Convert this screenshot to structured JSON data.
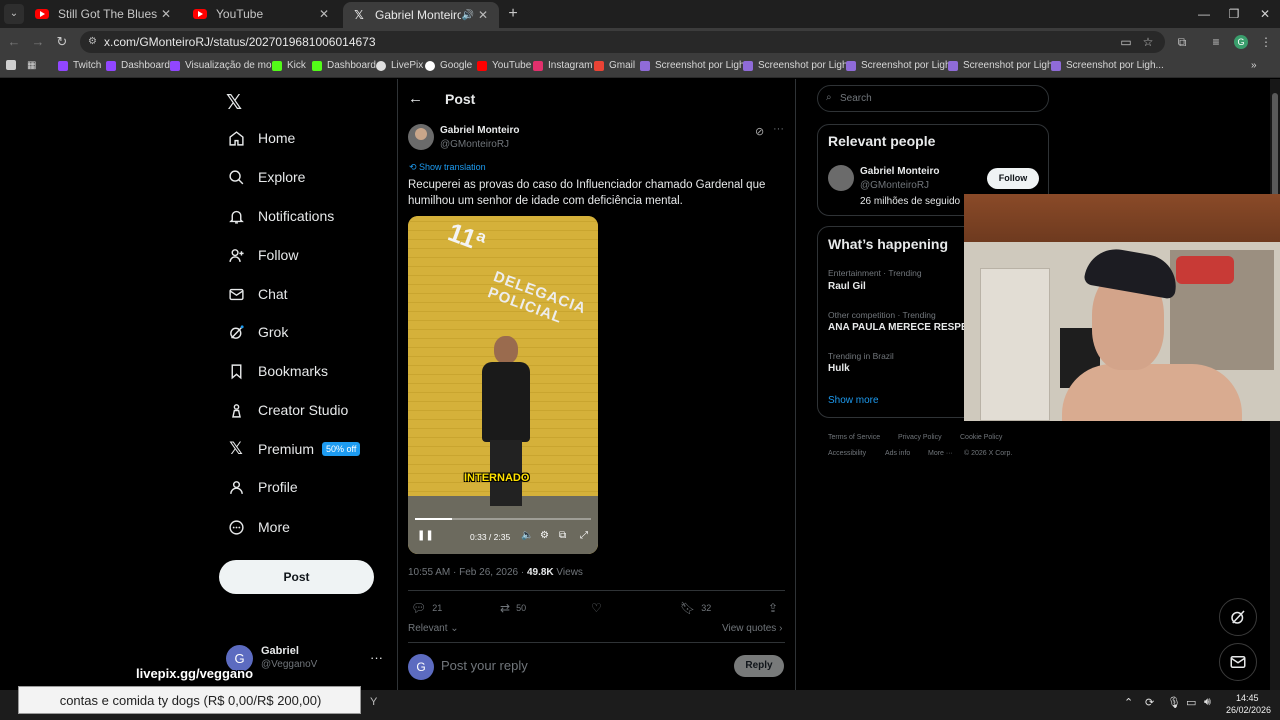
{
  "browser": {
    "tabs": [
      {
        "title": "Still Got The Blues - YouTube",
        "favicon": "youtube-icon"
      },
      {
        "title": "YouTube",
        "favicon": "youtube-icon"
      },
      {
        "title": "Gabriel Monteiro on X: \"Re",
        "favicon": "x-icon",
        "active": true
      }
    ],
    "url": "x.com/GMonteiroRJ/status/2027019681006014673",
    "bookmarks": [
      "Twitch",
      "Dashboard",
      "Visualização de mo...",
      "Kick",
      "Dashboard",
      "LivePix",
      "Google",
      "YouTube",
      "Instagram",
      "Gmail",
      "Screenshot por Ligh...",
      "Screenshot por Ligh...",
      "Screenshot por Ligh...",
      "Screenshot por Ligh...",
      "Screenshot por Ligh..."
    ],
    "profile_initial": "G"
  },
  "nav": {
    "items": [
      {
        "label": "Home",
        "icon": "home-icon"
      },
      {
        "label": "Explore",
        "icon": "search-icon"
      },
      {
        "label": "Notifications",
        "icon": "bell-icon"
      },
      {
        "label": "Follow",
        "icon": "add-person-icon"
      },
      {
        "label": "Chat",
        "icon": "mail-icon"
      },
      {
        "label": "Grok",
        "icon": "grok-icon"
      },
      {
        "label": "Bookmarks",
        "icon": "bookmark-icon"
      },
      {
        "label": "Creator Studio",
        "icon": "creator-icon"
      },
      {
        "label": "Premium",
        "icon": "x-icon"
      },
      {
        "label": "Profile",
        "icon": "person-icon"
      },
      {
        "label": "More",
        "icon": "more-circle-icon"
      }
    ],
    "premium_badge": "50% off",
    "post_button": "Post",
    "account": {
      "initial": "G",
      "name": "Gabriel",
      "handle": "@VegganoV"
    }
  },
  "post": {
    "heading": "Post",
    "author": {
      "name": "Gabriel Monteiro",
      "handle": "@GMonteiroRJ"
    },
    "show_translation": "Show translation",
    "text": "Recuperei as provas do caso do Influenciador chamado Gardenal que humilhou um senhor de idade com deficiência mental.",
    "video": {
      "sign_text": "11ª",
      "sign_text_2": "DELEGACIA POLICIAL",
      "caption": "INTERNADO",
      "time": "0:33 / 2:35",
      "progress": 0.213
    },
    "timestamp": "10:55 AM · Feb 26, 2026 · ",
    "views_count": "49.8K",
    "views_label": " Views",
    "actions": {
      "replies": "21",
      "reposts": "50",
      "likes": "",
      "bookmarks": "32"
    },
    "relevant": "Relevant ⌄",
    "view_quotes": "View quotes ›",
    "reply_placeholder": "Post your reply",
    "reply_button": "Reply",
    "reply_avatar_initial": "G"
  },
  "sidebar": {
    "search_placeholder": "Search",
    "relevant_people": {
      "title": "Relevant people",
      "name": "Gabriel Monteiro",
      "handle": "@GMonteiroRJ",
      "followers": "26 milhões de seguido",
      "follow_button": "Follow"
    },
    "happening": {
      "title": "What’s happening",
      "trends": [
        {
          "meta": "Entertainment · Trending",
          "name": "Raul Gil"
        },
        {
          "meta": "Other competition · Trending",
          "name": "ANA PAULA MERECE RESPEI"
        },
        {
          "meta": "Trending in Brazil",
          "name": "Hulk"
        }
      ],
      "show_more": "Show more"
    },
    "footer": [
      "Terms of Service",
      "Privacy Policy",
      "Cookie Policy",
      "Accessibility",
      "Ads info",
      "More ···",
      "© 2026 X Corp."
    ]
  },
  "overlay": {
    "livepix": "livepix.gg/veggano",
    "goal": "contas e comida ty dogs (R$ 0,00/R$ 200,00)"
  },
  "taskbar": {
    "time": "14:45",
    "date": "26/02/2026"
  }
}
